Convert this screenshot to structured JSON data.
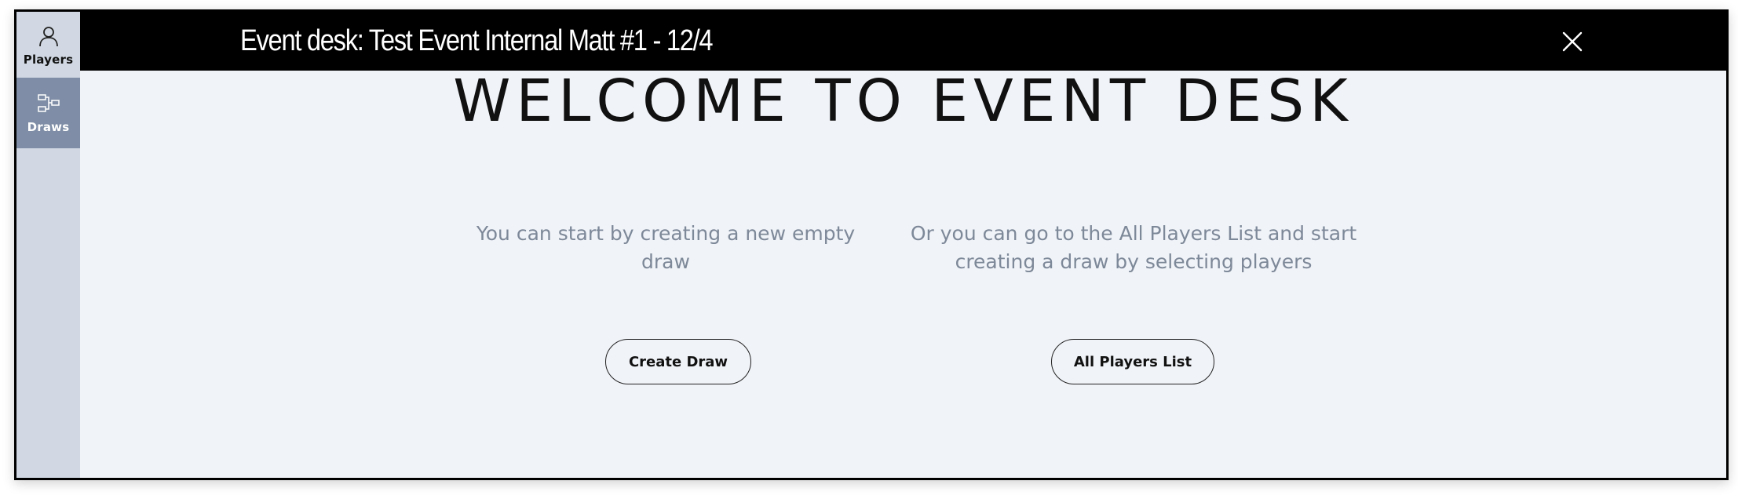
{
  "header": {
    "title": "Event desk: Test Event Internal Matt #1 - 12/4"
  },
  "sidebar": {
    "items": [
      {
        "label": "Players",
        "icon": "user-icon",
        "active": false
      },
      {
        "label": "Draws",
        "icon": "draw-bracket-icon",
        "active": true
      }
    ]
  },
  "main": {
    "heading": "WELCOME TO EVENT DESK",
    "left_text": "You can start by creating a new empty draw",
    "right_text": "Or you can go to the All Players List and start creating a draw by selecting players",
    "create_button": "Create Draw",
    "players_button": "All Players List"
  },
  "colors": {
    "header_bg": "#000000",
    "sidebar_bg": "#d1d8e3",
    "sidebar_active_bg": "#7f8ea6",
    "content_bg": "#f0f3f8",
    "muted_text": "#7d8898"
  }
}
